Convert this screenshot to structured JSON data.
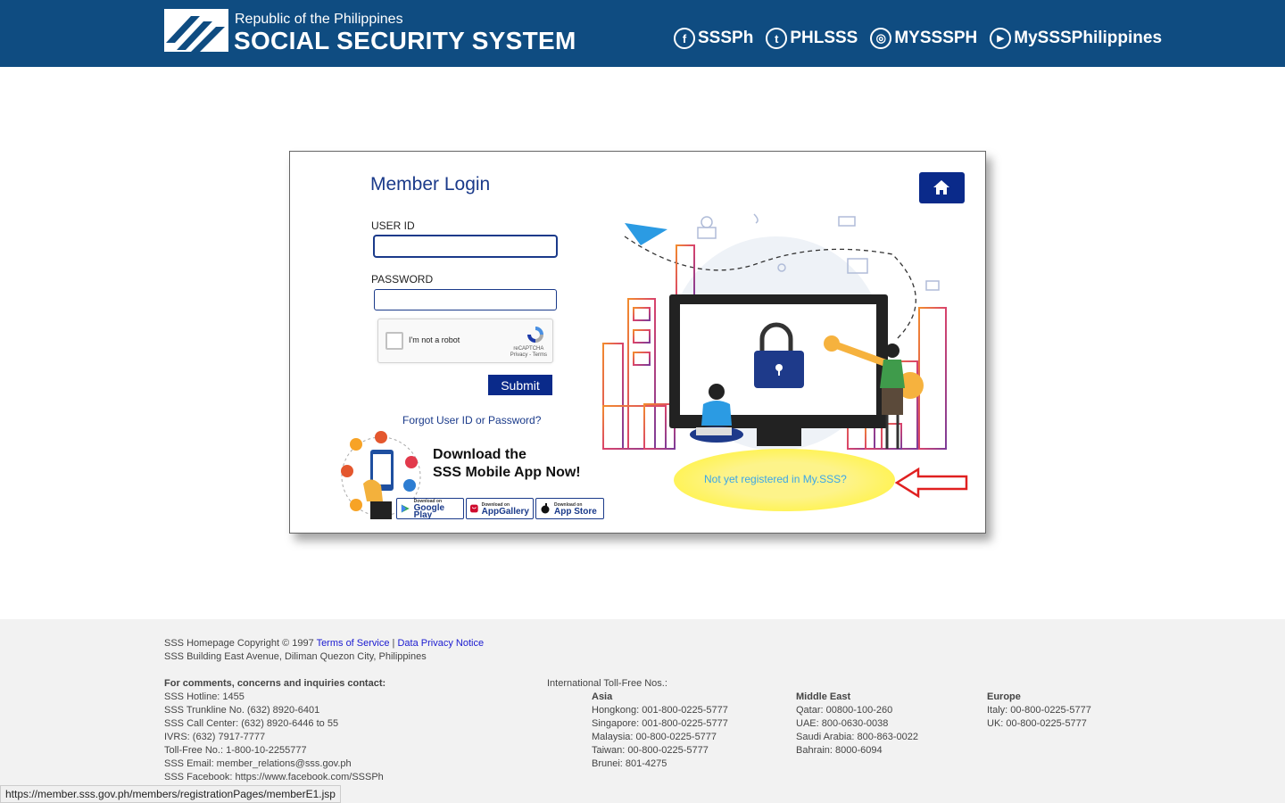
{
  "header": {
    "republic": "Republic of the Philippines",
    "title": "SOCIAL SECURITY SYSTEM",
    "socials": [
      {
        "icon": "facebook-icon",
        "glyph": "f",
        "label": "SSSPh"
      },
      {
        "icon": "twitter-icon",
        "glyph": "t",
        "label": "PHLSSS"
      },
      {
        "icon": "instagram-icon",
        "glyph": "◎",
        "label": "MYSSSPH"
      },
      {
        "icon": "youtube-icon",
        "glyph": "▶",
        "label": "MySSSPhilippines"
      }
    ],
    "bg_color": "#0f4c81"
  },
  "login": {
    "title": "Member Login",
    "user_id_label": "USER ID",
    "user_id_value": "",
    "password_label": "PASSWORD",
    "password_value": "",
    "captcha_label": "I'm not a robot",
    "captcha_brand": "reCAPTCHA",
    "captcha_links": "Privacy - Terms",
    "submit_label": "Submit",
    "forgot_label": "Forgot User ID or Password?"
  },
  "app_promo": {
    "line1": "Download the",
    "line2": "SSS Mobile App Now!",
    "stores": [
      {
        "small": "Download on",
        "name": "Google Play"
      },
      {
        "small": "Download on",
        "name": "AppGallery"
      },
      {
        "small": "Download on",
        "name": "App Store"
      }
    ]
  },
  "register_link": "Not yet registered in My.SSS?",
  "footer": {
    "copyright": "SSS Homepage Copyright © 1997",
    "terms": "Terms of Service",
    "separator": "|",
    "privacy": "Data Privacy Notice",
    "address": "SSS Building East Avenue, Diliman Quezon City, Philippines",
    "contact_heading": "For comments, concerns and inquiries contact:",
    "contacts": [
      "SSS Hotline: 1455",
      "SSS Trunkline No. (632) 8920-6401",
      "SSS Call Center: (632) 8920-6446 to 55",
      "IVRS: (632) 7917-7777",
      "Toll-Free No.: 1-800-10-2255777",
      "SSS Email: member_relations@sss.gov.ph",
      "SSS Facebook: https://www.facebook.com/SSSPh"
    ],
    "intl_heading": "International Toll-Free Nos.:",
    "asia_heading": "Asia",
    "asia": [
      "Hongkong: 001-800-0225-5777",
      "Singapore: 001-800-0225-5777",
      "Malaysia: 00-800-0225-5777",
      "Taiwan: 00-800-0225-5777",
      "Brunei: 801-4275"
    ],
    "me_heading": "Middle East",
    "middle_east": [
      "Qatar: 00800-100-260",
      "UAE: 800-0630-0038",
      "Saudi Arabia: 800-863-0022",
      "Bahrain: 8000-6094"
    ],
    "eu_heading": "Europe",
    "europe": [
      "Italy: 00-800-0225-5777",
      "UK: 00-800-0225-5777"
    ]
  },
  "status_url": "https://member.sss.gov.ph/members/registrationPages/memberE1.jsp"
}
